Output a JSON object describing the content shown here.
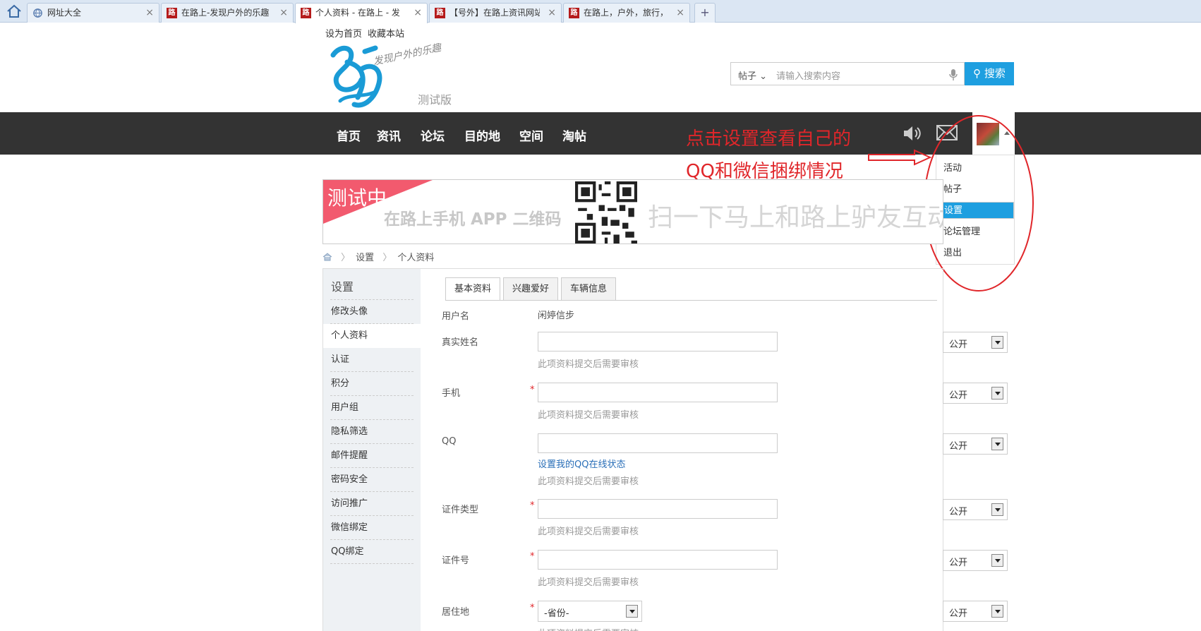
{
  "browser": {
    "tabs": [
      {
        "title": "网址大全",
        "icon": "globe-icon"
      },
      {
        "title": "在路上-发现户外的乐趣",
        "icon": "site-icon"
      },
      {
        "title": "个人资料 - 在路上 - 发",
        "icon": "site-icon"
      },
      {
        "title": "【号外】在路上资讯网站",
        "icon": "site-icon"
      },
      {
        "title": "在路上，户外，旅行，",
        "icon": "site-icon"
      }
    ],
    "favicon_char": "路",
    "new_tab": "+"
  },
  "header": {
    "top_links": [
      "设为首页",
      "收藏本站"
    ],
    "logo_tagline": "测试版",
    "logo_script": "发现户外的乐趣",
    "search": {
      "type": "帖子",
      "placeholder": "请输入搜索内容",
      "button": "搜索"
    }
  },
  "nav": {
    "items": [
      "首页",
      "资讯",
      "论坛",
      "目的地",
      "空间",
      "淘帖"
    ]
  },
  "annotation": {
    "line1": "点击设置查看自己的",
    "line2": "QQ和微信捆绑情况",
    "color": "#e0262a"
  },
  "user_menu": {
    "items": [
      "活动",
      "帖子",
      "设置",
      "论坛管理",
      "退出"
    ],
    "selected": "设置"
  },
  "banner": {
    "badge": "测试中",
    "app_text": "在路上手机 APP 二维码",
    "slogan": "扫一下马上和路上驴友互动"
  },
  "breadcrumb": [
    "设置",
    "个人资料"
  ],
  "sidebar": {
    "heading": "设置",
    "items": [
      "修改头像",
      "个人资料",
      "认证",
      "积分",
      "用户组",
      "隐私筛选",
      "邮件提醒",
      "密码安全",
      "访问推广",
      "微信绑定",
      "QQ绑定"
    ],
    "current": "个人资料"
  },
  "profile_tabs": [
    "基本资料",
    "兴趣爱好",
    "车辆信息"
  ],
  "form": {
    "username_label": "用户名",
    "username_value": "闲婷信步",
    "required_mark": "*",
    "review_note": "此项资料提交后需要审核",
    "privacy_option": "公开",
    "qq_link": "设置我的QQ在线状态",
    "province_placeholder": "-省份-",
    "fields": [
      {
        "label": "真实姓名",
        "required": false
      },
      {
        "label": "手机",
        "required": true
      },
      {
        "label": "QQ",
        "required": false
      },
      {
        "label": "证件类型",
        "required": true
      },
      {
        "label": "证件号",
        "required": true
      },
      {
        "label": "居住地",
        "required": true
      }
    ]
  },
  "colors": {
    "accent": "#1e9fe0",
    "nav_bg": "#333333",
    "annotation": "#e0262a"
  }
}
